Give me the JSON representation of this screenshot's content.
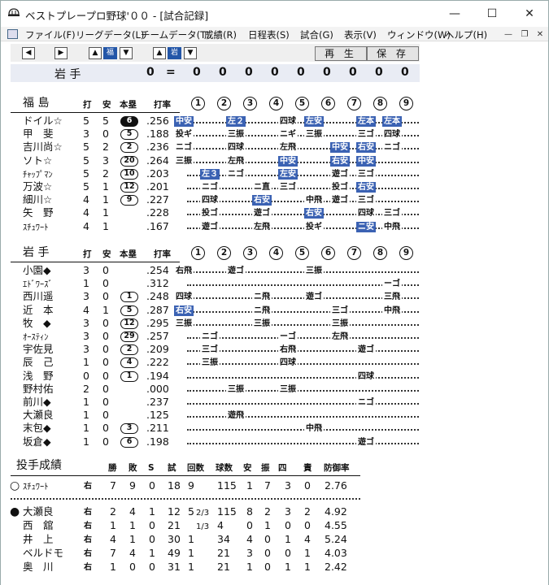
{
  "window": {
    "title": "ベストプレープロ野球'００ - [試合記録]"
  },
  "menu": [
    "ファイル(F)",
    "リーグデータ(L)",
    "チームデータ(T)",
    "成績(R)",
    "日程表(S)",
    "試合(G)",
    "表示(V)",
    "ウィンドウ(W)",
    "ヘルプ(H)"
  ],
  "toolbar": {
    "team1": "福",
    "team2": "岩",
    "play": "再 生",
    "save": "保 存"
  },
  "score": {
    "team": "岩 手",
    "total": "0",
    "eq": "=",
    "innings": [
      "0",
      "0",
      "0",
      "0",
      "0",
      "0",
      "0",
      "0",
      "0"
    ]
  },
  "inning_nums": [
    "1",
    "2",
    "3",
    "4",
    "5",
    "6",
    "7",
    "8",
    "9"
  ],
  "fukushima": {
    "team": "福 島",
    "headers": {
      "ab": "打",
      "h": "安",
      "hr": "本塁",
      "avg": "打率"
    },
    "rows": [
      {
        "name": "ドイル☆",
        "ab": "5",
        "h": "5",
        "hr": "6",
        "hr_fill": true,
        "avg": ".256",
        "plays": [
          [
            "中安",
            0,
            1
          ],
          [
            "左２",
            2,
            1
          ],
          [
            "四球",
            4,
            0
          ],
          [
            "左安",
            5,
            1
          ],
          [
            "左本",
            7,
            1
          ],
          [
            "左本",
            8,
            1
          ]
        ]
      },
      {
        "name": "甲　斐",
        "ab": "3",
        "h": "0",
        "hr": "5",
        "avg": ".188",
        "plays": [
          [
            "投ギ",
            0,
            0
          ],
          [
            "三振",
            2,
            0
          ],
          [
            "ニギ",
            4,
            0
          ],
          [
            "三振",
            5,
            0
          ],
          [
            "三ゴ",
            7,
            0
          ],
          [
            "四球",
            8,
            0
          ]
        ]
      },
      {
        "name": "吉川尚☆",
        "ab": "5",
        "h": "2",
        "hr": "2",
        "avg": ".236",
        "plays": [
          [
            "ニゴ",
            0,
            0
          ],
          [
            "四球",
            2,
            0
          ],
          [
            "左飛",
            4,
            0
          ],
          [
            "中安",
            6,
            1
          ],
          [
            "右安",
            7,
            1
          ],
          [
            "ニゴ",
            8,
            0
          ]
        ]
      },
      {
        "name": "ソト☆",
        "ab": "5",
        "h": "3",
        "hr": "20",
        "avg": ".264",
        "plays": [
          [
            "三振",
            0,
            0
          ],
          [
            "左飛",
            2,
            0
          ],
          [
            "中安",
            4,
            1
          ],
          [
            "右安",
            6,
            1
          ],
          [
            "中安",
            7,
            1
          ]
        ]
      },
      {
        "name": "ﾁｬｯﾌﾟﾏﾝ",
        "ab": "5",
        "h": "2",
        "hr": "10",
        "avg": ".203",
        "plays": [
          [
            "左３",
            1,
            1
          ],
          [
            "ニゴ",
            2,
            0
          ],
          [
            "左安",
            4,
            1
          ],
          [
            "遊ゴ",
            6,
            0
          ],
          [
            "三ゴ",
            7,
            0
          ]
        ]
      },
      {
        "name": "万波☆",
        "ab": "5",
        "h": "1",
        "hr": "12",
        "avg": ".201",
        "plays": [
          [
            "ニゴ",
            1,
            0
          ],
          [
            "ニ直",
            3,
            0
          ],
          [
            "三ゴ",
            4,
            0
          ],
          [
            "投ゴ",
            6,
            0
          ],
          [
            "右安",
            7,
            1
          ]
        ]
      },
      {
        "name": "細川☆",
        "ab": "4",
        "h": "1",
        "hr": "9",
        "avg": ".227",
        "plays": [
          [
            "四球",
            1,
            0
          ],
          [
            "右安",
            3,
            1
          ],
          [
            "中飛",
            5,
            0
          ],
          [
            "遊ゴ",
            6,
            0
          ],
          [
            "三ゴ",
            7,
            0
          ]
        ]
      },
      {
        "name": "矢　野",
        "ab": "4",
        "h": "1",
        "hr": "",
        "avg": ".228",
        "plays": [
          [
            "投ゴ",
            1,
            0
          ],
          [
            "遊ゴ",
            3,
            0
          ],
          [
            "右安",
            5,
            1
          ],
          [
            "四球",
            7,
            0
          ],
          [
            "三ゴ",
            8,
            0
          ]
        ]
      },
      {
        "name": "ｽﾁｭﾜｰﾄ",
        "ab": "4",
        "h": "1",
        "hr": "",
        "avg": ".167",
        "plays": [
          [
            "遊ゴ",
            1,
            0
          ],
          [
            "左飛",
            3,
            0
          ],
          [
            "投ギ",
            5,
            0
          ],
          [
            "ニ安",
            7,
            1
          ],
          [
            "中飛",
            8,
            0
          ]
        ]
      }
    ]
  },
  "iwate": {
    "team": "岩 手",
    "headers": {
      "ab": "打",
      "h": "安",
      "hr": "本塁",
      "avg": "打率"
    },
    "rows": [
      {
        "name": "小園◆",
        "ab": "3",
        "h": "0",
        "hr": "",
        "avg": ".254",
        "plays": [
          [
            "右飛",
            0,
            0
          ],
          [
            "遊ゴ",
            2,
            0
          ],
          [
            "三振",
            5,
            0
          ]
        ]
      },
      {
        "name": "ｴﾄﾞﾜｰｽﾞ",
        "ab": "1",
        "h": "0",
        "hr": "",
        "avg": ".312",
        "plays": [
          [
            "ーゴ",
            8,
            0
          ]
        ]
      },
      {
        "name": "西川遥",
        "ab": "3",
        "h": "0",
        "hr": "1",
        "avg": ".248",
        "plays": [
          [
            "四球",
            0,
            0
          ],
          [
            "ニ飛",
            3,
            0
          ],
          [
            "遊ゴ",
            5,
            0
          ],
          [
            "三飛",
            8,
            0
          ]
        ]
      },
      {
        "name": "近　本",
        "ab": "4",
        "h": "1",
        "hr": "5",
        "avg": ".287",
        "plays": [
          [
            "右安",
            0,
            1
          ],
          [
            "ニ飛",
            3,
            0
          ],
          [
            "三ゴ",
            6,
            0
          ],
          [
            "中飛",
            8,
            0
          ]
        ]
      },
      {
        "name": "牧　◆",
        "ab": "3",
        "h": "0",
        "hr": "12",
        "avg": ".295",
        "plays": [
          [
            "三振",
            0,
            0
          ],
          [
            "三振",
            3,
            0
          ],
          [
            "三振",
            6,
            0
          ]
        ]
      },
      {
        "name": "ｵｰｽﾃｨﾝ",
        "ab": "3",
        "h": "0",
        "hr": "29",
        "avg": ".257",
        "plays": [
          [
            "ニゴ",
            1,
            0
          ],
          [
            "ーゴ",
            4,
            0
          ],
          [
            "左飛",
            6,
            0
          ]
        ]
      },
      {
        "name": "宇佐見",
        "ab": "3",
        "h": "0",
        "hr": "2",
        "avg": ".209",
        "plays": [
          [
            "三ゴ",
            1,
            0
          ],
          [
            "右飛",
            4,
            0
          ],
          [
            "遊ゴ",
            7,
            0
          ]
        ]
      },
      {
        "name": "辰　己",
        "ab": "1",
        "h": "0",
        "hr": "4",
        "avg": ".222",
        "plays": [
          [
            "三振",
            1,
            0
          ],
          [
            "四球",
            4,
            0
          ]
        ]
      },
      {
        "name": "浅　野",
        "ab": "0",
        "h": "0",
        "hr": "1",
        "avg": ".194",
        "plays": [
          [
            "四球",
            7,
            0
          ]
        ]
      },
      {
        "name": "野村佑",
        "ab": "2",
        "h": "0",
        "hr": "",
        "avg": ".000",
        "plays": [
          [
            "三振",
            2,
            0
          ],
          [
            "三振",
            4,
            0
          ]
        ]
      },
      {
        "name": "前川◆",
        "ab": "1",
        "h": "0",
        "hr": "",
        "avg": ".237",
        "plays": [
          [
            "ニゴ",
            7,
            0
          ]
        ]
      },
      {
        "name": "大瀬良",
        "ab": "1",
        "h": "0",
        "hr": "",
        "avg": ".125",
        "plays": [
          [
            "遊飛",
            2,
            0
          ]
        ]
      },
      {
        "name": "末包◆",
        "ab": "1",
        "h": "0",
        "hr": "3",
        "avg": ".211",
        "plays": [
          [
            "中飛",
            5,
            0
          ]
        ]
      },
      {
        "name": "坂倉◆",
        "ab": "1",
        "h": "0",
        "hr": "6",
        "avg": ".198",
        "plays": [
          [
            "遊ゴ",
            7,
            0
          ]
        ]
      }
    ]
  },
  "pitching": {
    "title": "投手成績",
    "headers": [
      "勝",
      "敗",
      "S",
      "試",
      "回数",
      "球数",
      "安",
      "振",
      "四",
      "責",
      "防御率"
    ],
    "winner": {
      "mark": "○",
      "name": "ｽﾁｭﾜｰﾄ",
      "hand": "右",
      "w": "7",
      "l": "9",
      "s": "0",
      "g": "18",
      "ip": "9",
      "ip_frac": "",
      "pc": "115",
      "h": "1",
      "k": "7",
      "bb": "3",
      "er": "0",
      "era": "2.76"
    },
    "losers": [
      {
        "mark": "●",
        "name": "大瀬良",
        "hand": "右",
        "w": "2",
        "l": "4",
        "s": "1",
        "g": "12",
        "ip": "5",
        "ip_frac": "2/3",
        "pc": "115",
        "h": "8",
        "k": "2",
        "bb": "3",
        "er": "2",
        "era": "4.92"
      },
      {
        "mark": "",
        "name": "西　舘",
        "hand": "右",
        "w": "1",
        "l": "1",
        "s": "0",
        "g": "21",
        "ip": "",
        "ip_frac": "1/3",
        "pc": "4",
        "h": "0",
        "k": "1",
        "bb": "0",
        "er": "0",
        "era": "4.55"
      },
      {
        "mark": "",
        "name": "井　上",
        "hand": "右",
        "w": "4",
        "l": "1",
        "s": "0",
        "g": "30",
        "ip": "1",
        "ip_frac": "",
        "pc": "34",
        "h": "4",
        "k": "0",
        "bb": "1",
        "er": "4",
        "era": "5.24"
      },
      {
        "mark": "",
        "name": "ベルドモ",
        "hand": "右",
        "w": "7",
        "l": "4",
        "s": "1",
        "g": "49",
        "ip": "1",
        "ip_frac": "",
        "pc": "21",
        "h": "3",
        "k": "0",
        "bb": "0",
        "er": "1",
        "era": "4.03"
      },
      {
        "mark": "",
        "name": "奥　川",
        "hand": "右",
        "w": "1",
        "l": "0",
        "s": "0",
        "g": "31",
        "ip": "1",
        "ip_frac": "",
        "pc": "21",
        "h": "1",
        "k": "0",
        "bb": "1",
        "er": "1",
        "era": "2.42"
      }
    ]
  }
}
